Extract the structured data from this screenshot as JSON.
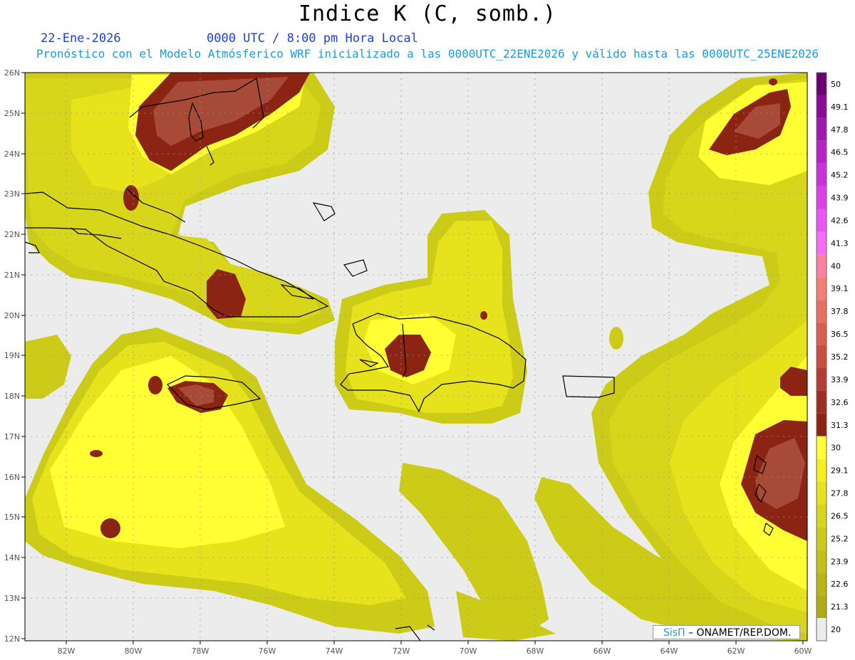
{
  "title": "Indice K (C, somb.)",
  "date": "22-Ene-2026",
  "time": "0000 UTC / 8:00 pm Hora Local",
  "subtitle": "Pronóstico con el Modelo Atmósferico WRF inicializado a las 0000UTC_22ENE2026 y válido hasta las  0000UTC_25ENE2026",
  "credit_logo": "SisΠ",
  "credit_text": "– ONAMET/REP.DOM.",
  "lon_labels": [
    "82W",
    "80W",
    "78W",
    "76W",
    "74W",
    "72W",
    "70W",
    "68W",
    "66W",
    "64W",
    "62W",
    "60W"
  ],
  "lat_labels": [
    "26N",
    "25N",
    "24N",
    "23N",
    "22N",
    "21N",
    "20N",
    "19N",
    "18N",
    "17N",
    "16N",
    "15N",
    "14N",
    "13N",
    "12N"
  ],
  "colorbar": {
    "labels": [
      "50",
      "49.1",
      "47.8",
      "46.5",
      "45.2",
      "43.9",
      "42.6",
      "41.3",
      "40",
      "39.1",
      "37.8",
      "36.5",
      "35.2",
      "33.9",
      "32.6",
      "31.3",
      "30",
      "29.1",
      "27.8",
      "26.5",
      "25.2",
      "23.9",
      "22.6",
      "21.3",
      "20"
    ],
    "colors": [
      "#6a006f",
      "#8a0a93",
      "#a018ae",
      "#b822c8",
      "#cc2fdc",
      "#dd3fe8",
      "#ec55f0",
      "#f46df4",
      "#ff80a0",
      "#f57f75",
      "#e86f63",
      "#d85f52",
      "#c84e42",
      "#b53d33",
      "#a02d22",
      "#8c2414",
      "#ffff33",
      "#f4f020",
      "#e6e21c",
      "#d8d61a",
      "#cccc18",
      "#c2c116",
      "#b8b614",
      "#aeac12",
      "#ececec"
    ]
  }
}
